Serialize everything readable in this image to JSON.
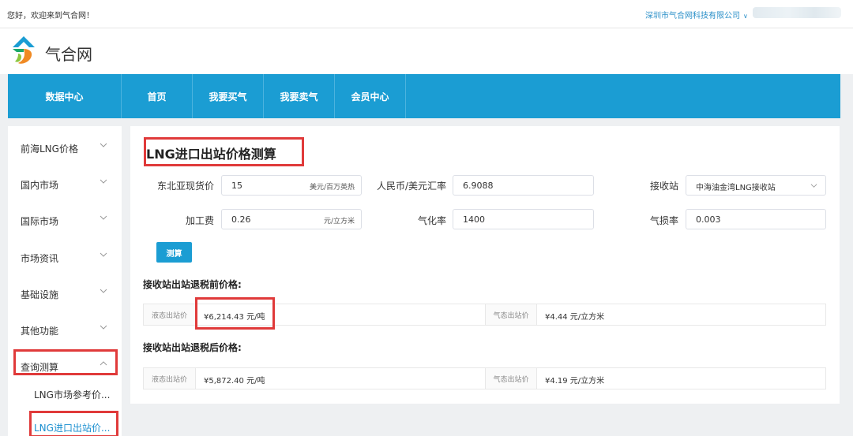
{
  "topbar": {
    "welcome": "您好，欢迎来到气合网！",
    "company": "深圳市气合网科技有限公司"
  },
  "header": {
    "brand": "气合网"
  },
  "nav": {
    "items": [
      "数据中心",
      "首页",
      "我要买气",
      "我要卖气",
      "会员中心"
    ]
  },
  "sidebar": {
    "items": [
      "前海LNG价格",
      "国内市场",
      "国际市场",
      "市场资讯",
      "基础设施",
      "其他功能",
      "查询测算"
    ],
    "sub_items": [
      "LNG市场参考价...",
      "LNG进口出站价..."
    ]
  },
  "main": {
    "title": "LNG进口出站价格测算",
    "fields": {
      "spot_label": "东北亚现货价",
      "spot_value": "15",
      "spot_unit": "美元/百万英热",
      "rate_label": "人民币/美元汇率",
      "rate_value": "6.9088",
      "terminal_label": "接收站",
      "terminal_value": "中海油金湾LNG接收站",
      "fee_label": "加工费",
      "fee_value": "0.26",
      "fee_unit": "元/立方米",
      "gasify_label": "气化率",
      "gasify_value": "1400",
      "loss_label": "气损率",
      "loss_value": "0.003"
    },
    "calc_button": "测算",
    "before_tax": {
      "heading": "接收站出站退税前价格:",
      "liquid_label": "液态出站价",
      "liquid_value": "¥6,214.43 元/吨",
      "gas_label": "气态出站价",
      "gas_value": "¥4.44 元/立方米"
    },
    "after_tax": {
      "heading": "接收站出站退税后价格:",
      "liquid_label": "液态出站价",
      "liquid_value": "¥5,872.40 元/吨",
      "gas_label": "气态出站价",
      "gas_value": "¥4.19 元/立方米"
    }
  },
  "colors": {
    "accent": "#1b9dd3",
    "highlight": "#e03a3a"
  }
}
